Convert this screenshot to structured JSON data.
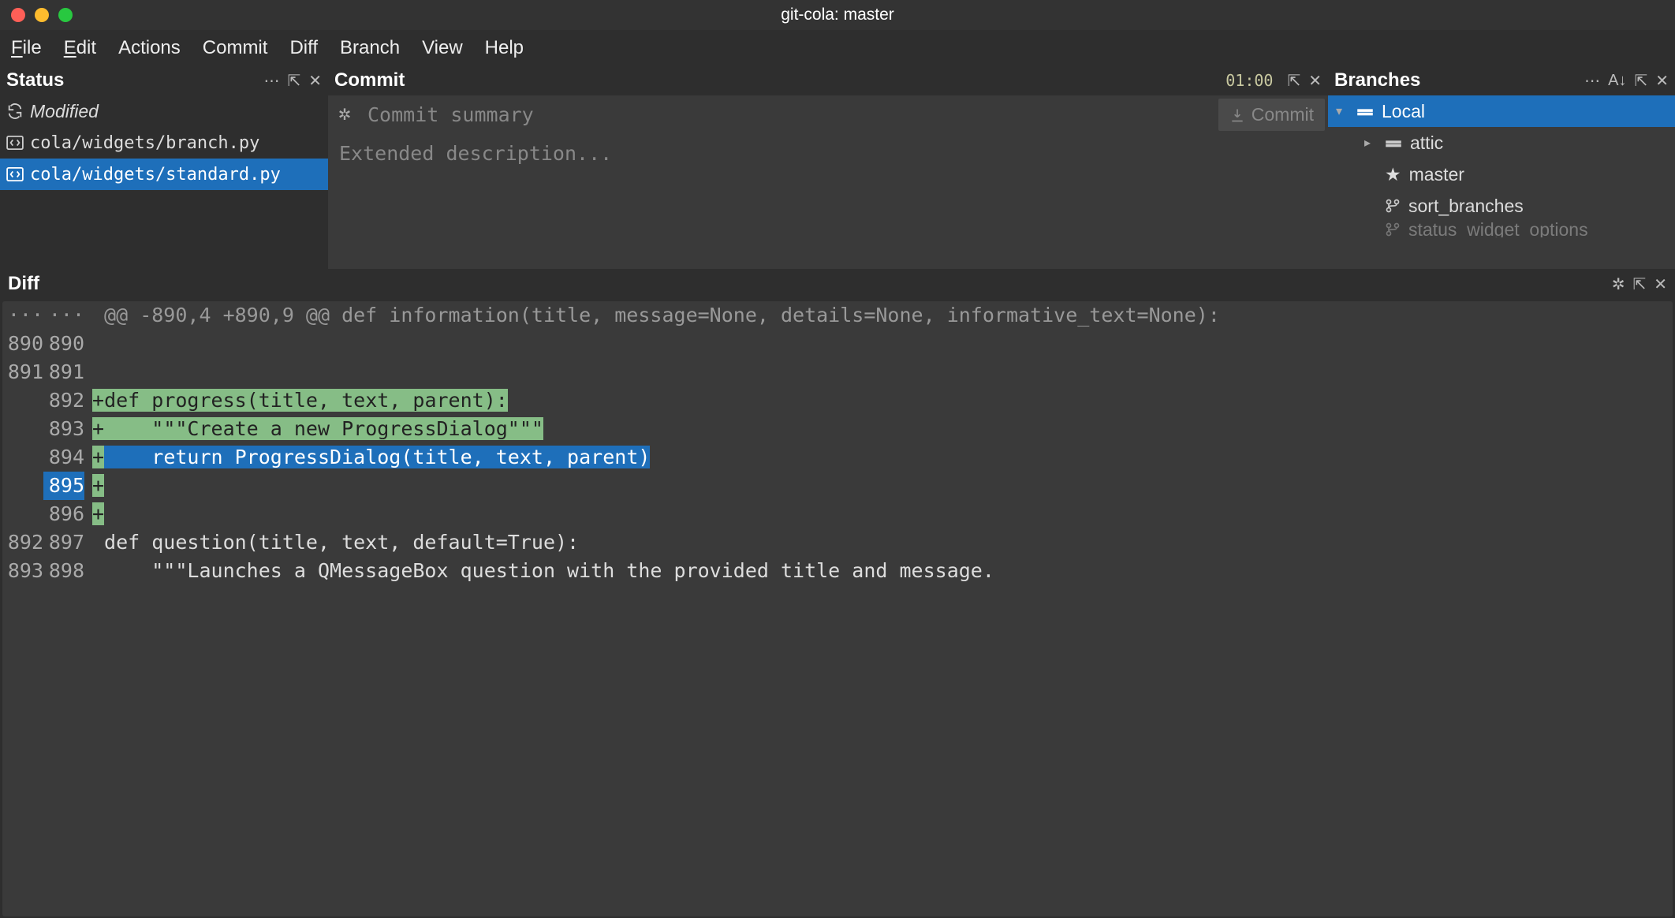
{
  "window": {
    "title": "git-cola: master"
  },
  "menu": {
    "file": "File",
    "edit": "Edit",
    "actions": "Actions",
    "commit": "Commit",
    "diff": "Diff",
    "branch": "Branch",
    "view": "View",
    "help": "Help"
  },
  "status": {
    "title": "Status",
    "section_label": "Modified",
    "files": [
      {
        "path": "cola/widgets/branch.py",
        "selected": false
      },
      {
        "path": "cola/widgets/standard.py",
        "selected": true
      }
    ]
  },
  "commit": {
    "title": "Commit",
    "counter": "01:00",
    "summary_placeholder": "Commit summary",
    "description_placeholder": "Extended description...",
    "button_label": "Commit"
  },
  "branches": {
    "title": "Branches",
    "root": "Local",
    "items": [
      {
        "name": "attic",
        "icon": "folder",
        "selected": false,
        "disclosure": true
      },
      {
        "name": "master",
        "icon": "star",
        "selected": false,
        "disclosure": false
      },
      {
        "name": "sort_branches",
        "icon": "branch",
        "selected": false,
        "disclosure": false
      },
      {
        "name": "status_widget_options",
        "icon": "branch",
        "selected": false,
        "disclosure": false
      }
    ]
  },
  "diff": {
    "title": "Diff",
    "hunk_header": "@@ -890,4 +890,9 @@ def information(title, message=None, details=None, informative_text=None):",
    "lines": [
      {
        "old": "...",
        "new": "...",
        "type": "hunk"
      },
      {
        "old": "890",
        "new": "890",
        "type": "ctx",
        "text": ""
      },
      {
        "old": "891",
        "new": "891",
        "type": "ctx",
        "text": ""
      },
      {
        "old": "",
        "new": "892",
        "type": "add",
        "text": "def progress(title, text, parent):",
        "style": "green"
      },
      {
        "old": "",
        "new": "893",
        "type": "add",
        "text": "    \"\"\"Create a new ProgressDialog\"\"\"",
        "style": "green"
      },
      {
        "old": "",
        "new": "894",
        "type": "add",
        "text": "    return ProgressDialog(title, text, parent)",
        "style": "blue"
      },
      {
        "old": "",
        "new": "895",
        "type": "add",
        "text": "",
        "style": "cursor"
      },
      {
        "old": "",
        "new": "896",
        "type": "add",
        "text": "",
        "style": "plain"
      },
      {
        "old": "892",
        "new": "897",
        "type": "ctx",
        "text": " def question(title, text, default=True):"
      },
      {
        "old": "893",
        "new": "898",
        "type": "ctx",
        "text": "     \"\"\"Launches a QMessageBox question with the provided title and message."
      }
    ]
  }
}
